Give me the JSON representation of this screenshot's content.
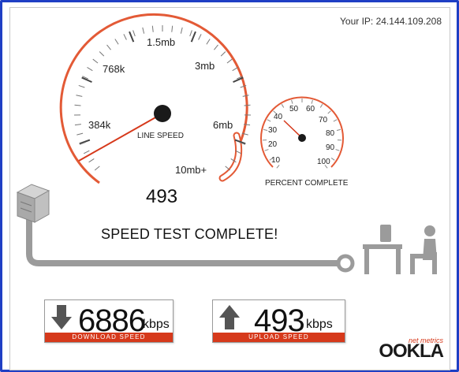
{
  "header": {
    "ip_label": "Your IP: 24.144.109.208"
  },
  "speed_gauge": {
    "ticks": [
      "384k",
      "768k",
      "1.5mb",
      "3mb",
      "6mb",
      "10mb+"
    ],
    "caption": "LINE SPEED",
    "reading": "493"
  },
  "percent_gauge": {
    "ticks": [
      "10",
      "20",
      "30",
      "40",
      "50",
      "60",
      "70",
      "80",
      "90",
      "100"
    ],
    "caption": "PERCENT COMPLETE"
  },
  "status": "SPEED TEST COMPLETE!",
  "download": {
    "value": "6886",
    "unit": "kbps",
    "label": "DOWNLOAD SPEED"
  },
  "upload": {
    "value": "493",
    "unit": "kbps",
    "label": "UPLOAD SPEED"
  },
  "brand": {
    "name": "OOKLA",
    "tagline": "net metrics"
  },
  "colors": {
    "accent": "#d6391b",
    "frame": "#1f3fc4",
    "cable": "#9b9b9b"
  }
}
